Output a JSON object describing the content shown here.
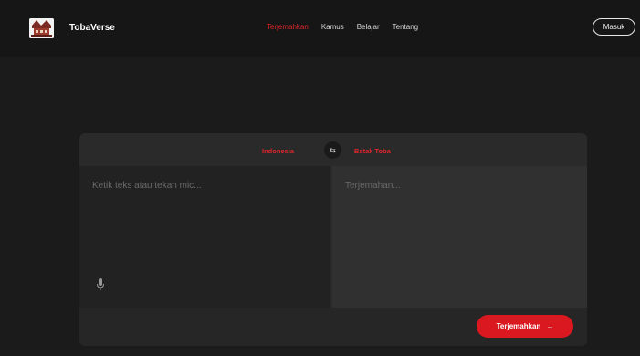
{
  "brand": {
    "name": "TobaVerse"
  },
  "nav": {
    "items": [
      {
        "label": "Terjemahkan",
        "active": true
      },
      {
        "label": "Kamus",
        "active": false
      },
      {
        "label": "Belajar",
        "active": false
      },
      {
        "label": "Tentang",
        "active": false
      }
    ],
    "login_label": "Masuk"
  },
  "translator": {
    "source_lang": "Indonesia",
    "target_lang": "Batak Toba",
    "input_placeholder": "Ketik teks atau tekan mic...",
    "output_placeholder": "Terjemahan...",
    "translate_label": "Terjemahkan",
    "translate_arrow": "→",
    "swap_glyph": "⇆"
  },
  "icons": {
    "swap": "swap-icon",
    "mic": "mic-icon",
    "logo": "logo-icon"
  },
  "colors": {
    "accent": "#e0262b",
    "button": "#d9191f",
    "background": "#1b1b1b",
    "card": "#2a2a2a"
  }
}
